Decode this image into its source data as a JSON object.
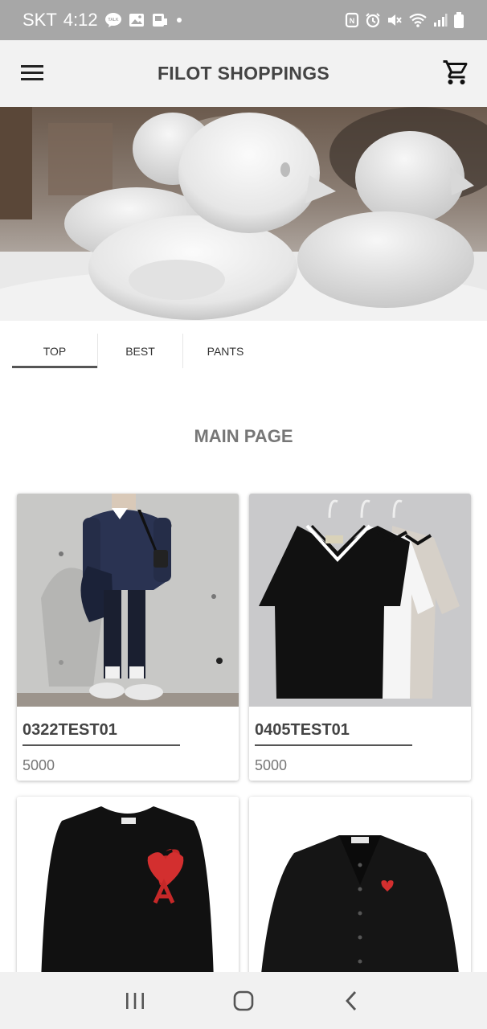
{
  "status_bar": {
    "carrier": "SKT",
    "time": "4:12",
    "left_icons": [
      "talk-icon",
      "gallery-icon",
      "sim-icon",
      "dot-icon"
    ],
    "right_icons": [
      "nfc-icon",
      "alarm-icon",
      "mute-icon",
      "wifi-icon",
      "signal-icon",
      "battery-icon"
    ]
  },
  "app_bar": {
    "title": "FILOT SHOPPINGS",
    "menu_icon": "hamburger-menu-icon",
    "cart_icon": "shopping-cart-icon"
  },
  "banner": {
    "image": "snow-ducks-photo"
  },
  "tabs": [
    {
      "label": "TOP",
      "active": true
    },
    {
      "label": "BEST",
      "active": false
    },
    {
      "label": "PANTS",
      "active": false
    }
  ],
  "section": {
    "title": "MAIN PAGE"
  },
  "products": [
    {
      "name": "0322TEST01",
      "price": "5000",
      "image": "navy-sweater-outfit-photo"
    },
    {
      "name": "0405TEST01",
      "price": "5000",
      "image": "vneck-tshirts-photo"
    },
    {
      "name": "",
      "price": "",
      "image": "black-heart-sweater-photo"
    },
    {
      "name": "",
      "price": "",
      "image": "black-cardigan-photo"
    }
  ],
  "nav_bar": {
    "items": [
      "recent-apps-icon",
      "home-icon",
      "back-icon"
    ]
  },
  "colors": {
    "status_bar_bg": "#a7a7a7",
    "app_bar_bg": "#f2f2f2",
    "title_text": "#444444",
    "section_title": "#777777",
    "nav_bar_bg": "#f1f1f1"
  }
}
